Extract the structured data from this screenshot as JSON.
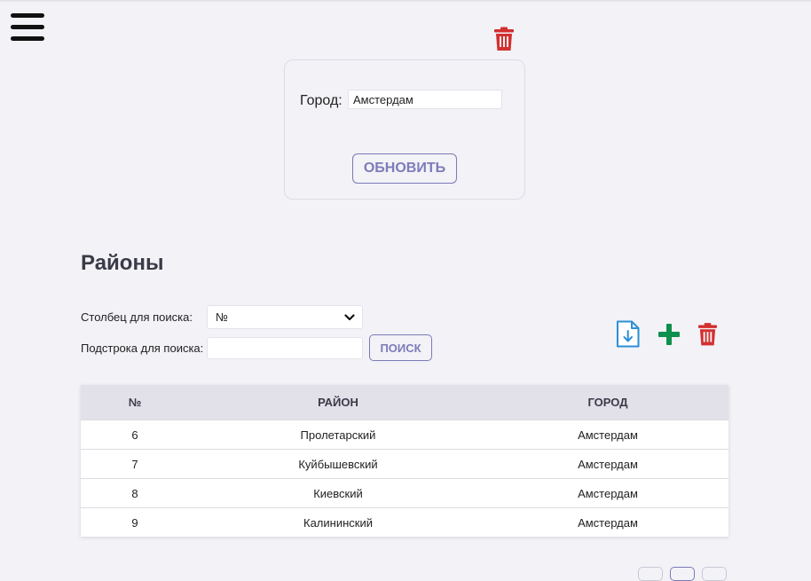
{
  "city_card": {
    "label": "Город:",
    "value": "Амстердам",
    "refresh_label": "ОБНОВИТЬ"
  },
  "section_title": "Районы",
  "search": {
    "column_label": "Столбец для поиска:",
    "column_value": "№",
    "substring_label": "Подстрока для поиска:",
    "substring_value": "",
    "button_label": "ПОИСК"
  },
  "table": {
    "headers": [
      "№",
      "РАЙОН",
      "ГОРОД"
    ],
    "rows": [
      [
        "6",
        "Пролетарский",
        "Амстердам"
      ],
      [
        "7",
        "Куйбышевский",
        "Амстердам"
      ],
      [
        "8",
        "Киевский",
        "Амстердам"
      ],
      [
        "9",
        "Калининский",
        "Амстердам"
      ]
    ]
  },
  "icons": {
    "menu": "menu-icon",
    "delete": "trash-icon",
    "export": "file-download-icon",
    "add": "plus-icon"
  },
  "colors": {
    "accent": "#7e7bb9",
    "delete": "#d32f2f",
    "add": "#0f8f4d",
    "export": "#2b8fd6"
  }
}
